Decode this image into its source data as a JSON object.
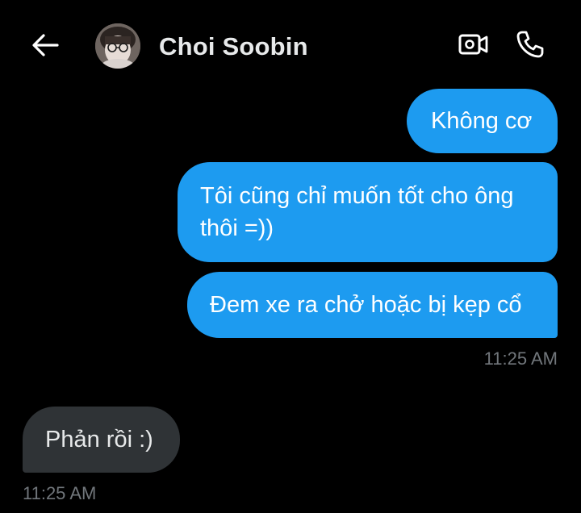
{
  "header": {
    "contact_name": "Choi Soobin",
    "back_icon": "arrow-left-icon",
    "video_icon": "video-camera-icon",
    "call_icon": "phone-icon",
    "text_color": "#e7e9ea"
  },
  "messages": {
    "sent": [
      {
        "text": "Không cơ"
      },
      {
        "text": "Tôi cũng chỉ muốn tốt cho ông thôi =))"
      },
      {
        "text": "Đem xe ra chở hoặc bị kẹp cổ"
      }
    ],
    "sent_time": "11:25 AM",
    "received": [
      {
        "text": "Phản rồi :)"
      }
    ],
    "received_time": "11:25 AM"
  },
  "colors": {
    "background": "#000000",
    "sent_bubble": "#1d9bf0",
    "received_bubble": "#2f3336",
    "timestamp": "#71767b"
  }
}
